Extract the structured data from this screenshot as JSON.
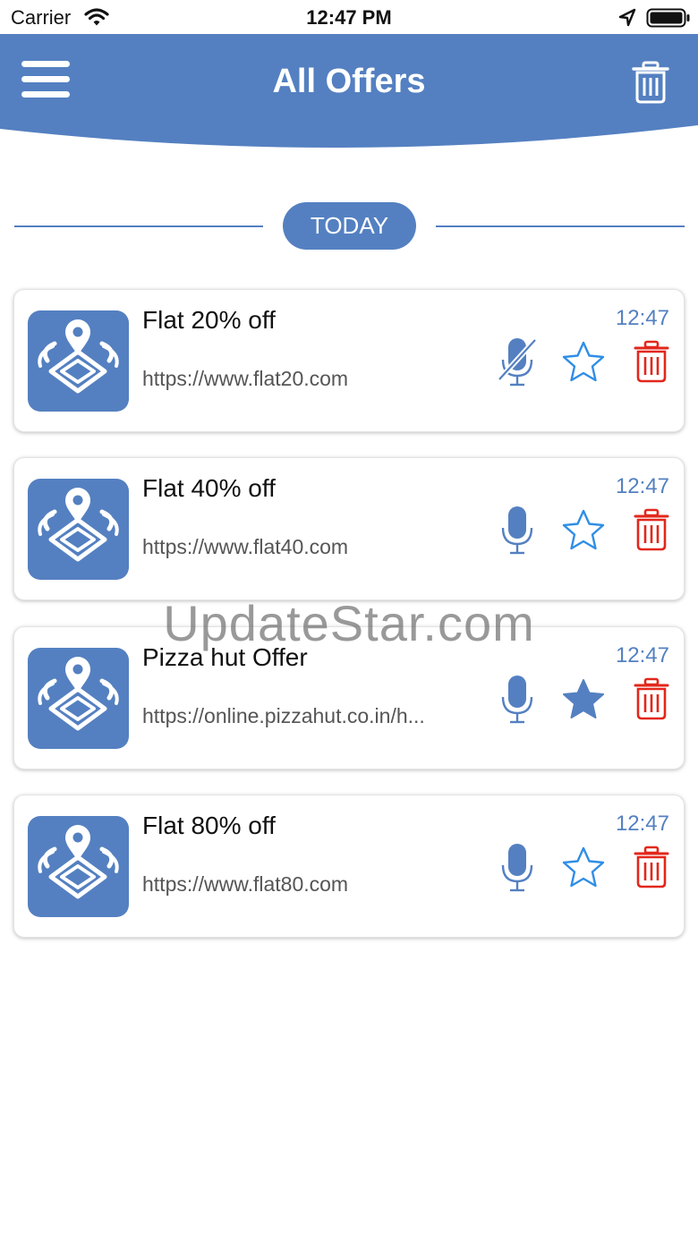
{
  "status_bar": {
    "carrier": "Carrier",
    "time": "12:47 PM"
  },
  "header": {
    "title": "All Offers",
    "menu_icon": "hamburger-menu-icon",
    "trash_icon": "trash-icon"
  },
  "section": {
    "label": "TODAY"
  },
  "offers": [
    {
      "title": "Flat 20% off",
      "url": "https://www.flat20.com",
      "time": "12:47",
      "mic_muted": true,
      "favorite": false
    },
    {
      "title": "Flat 40% off",
      "url": "https://www.flat40.com",
      "time": "12:47",
      "mic_muted": false,
      "favorite": false
    },
    {
      "title": "Pizza hut Offer",
      "url": "https://online.pizzahut.co.in/h...",
      "time": "12:47",
      "mic_muted": false,
      "favorite": true
    },
    {
      "title": "Flat 80% off",
      "url": "https://www.flat80.com",
      "time": "12:47",
      "mic_muted": false,
      "favorite": false
    }
  ],
  "watermark": "UpdateStar.com",
  "colors": {
    "brand_blue": "#5480c1",
    "delete_red": "#e2271b",
    "star_blue": "#2f8ee6"
  }
}
